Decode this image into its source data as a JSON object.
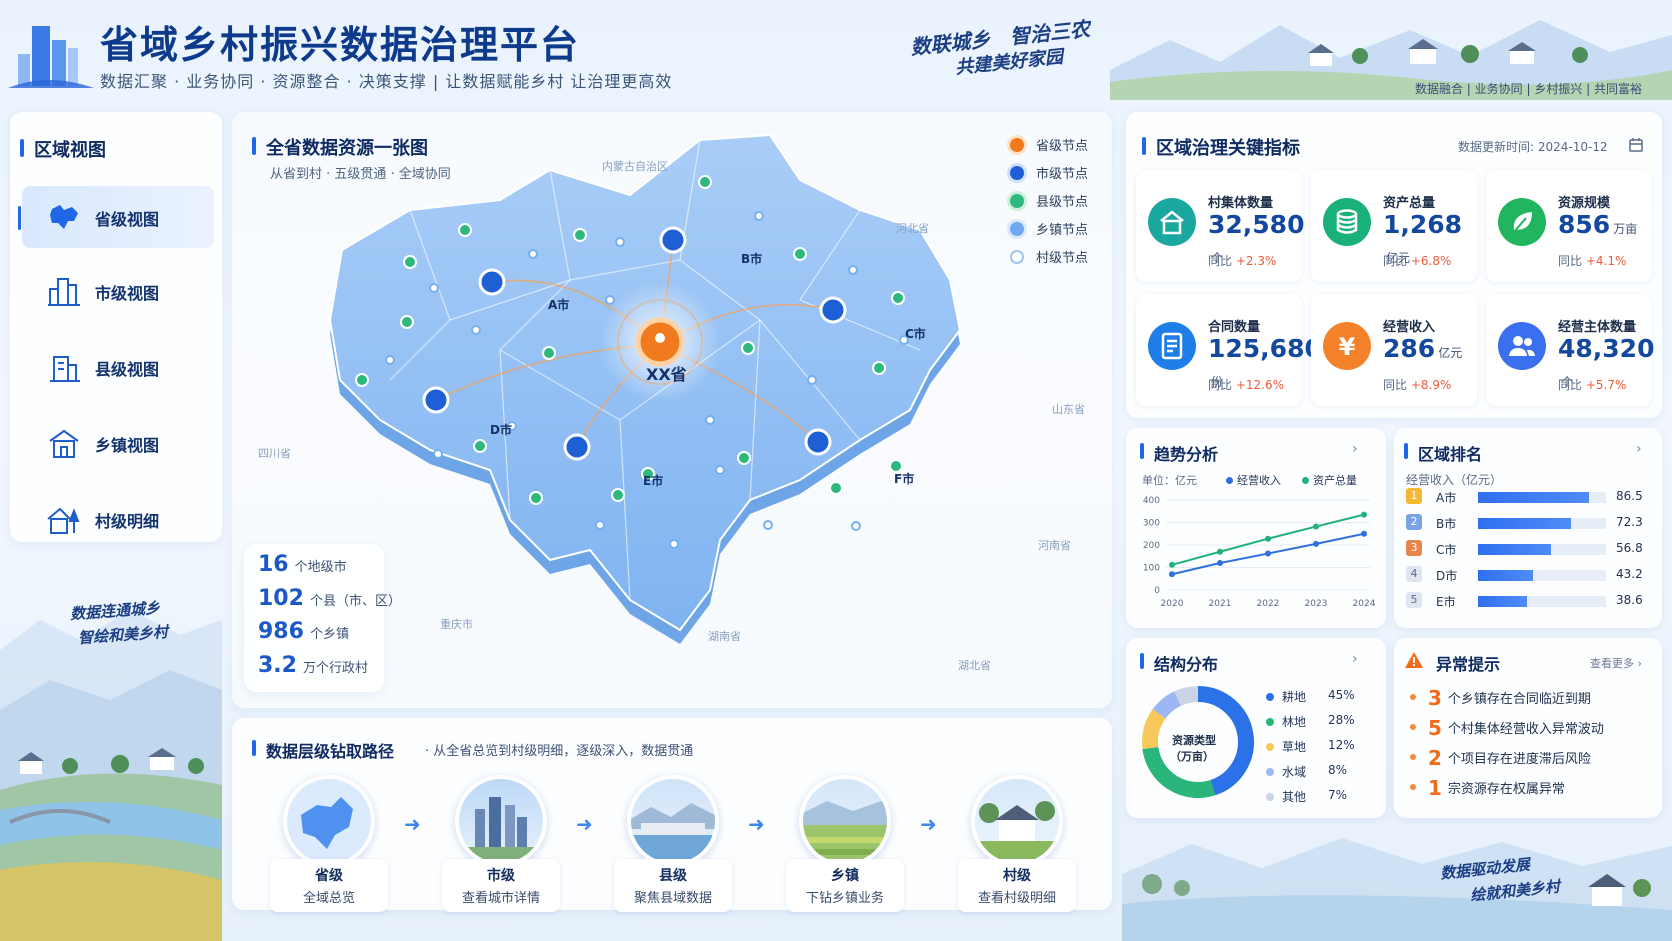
{
  "header": {
    "title": "省域乡村振兴数据治理平台",
    "subtitle": "数据汇聚 · 业务协同 · 资源整合 · 决策支撑 | 让数据赋能乡村 让治理更高效",
    "slogan_line1": "数联城乡　智治三农",
    "slogan_line2": "共建美好家园",
    "tagline": "数据融合 | 业务协同 | 乡村振兴 | 共同富裕"
  },
  "sidebar": {
    "title": "区域视图",
    "items": [
      {
        "label": "省级视图",
        "icon": "province-map-icon",
        "active": true
      },
      {
        "label": "市级视图",
        "icon": "city-building-icon",
        "active": false
      },
      {
        "label": "县级视图",
        "icon": "county-building-icon",
        "active": false
      },
      {
        "label": "乡镇视图",
        "icon": "town-house-icon",
        "active": false
      },
      {
        "label": "村级明细",
        "icon": "village-house-icon",
        "active": false
      }
    ],
    "slogan_line1": "数据连通城乡",
    "slogan_line2": "智绘和美乡村"
  },
  "map": {
    "title": "全省数据资源一张图",
    "subtitle": "从省到村 · 五级贯通 · 全域协同",
    "center_label": "XX省",
    "cities": [
      "A市",
      "B市",
      "C市",
      "D市",
      "E市",
      "F市"
    ],
    "regions": [
      "内蒙古自治区",
      "河北省",
      "山东省",
      "河南省",
      "湖北省",
      "湖南省",
      "重庆市",
      "四川省"
    ],
    "legend": [
      "省级节点",
      "市级节点",
      "县级节点",
      "乡镇节点",
      "村级节点"
    ],
    "stats": [
      {
        "value": "16",
        "label": "个地级市"
      },
      {
        "value": "102",
        "label": "个县（市、区）"
      },
      {
        "value": "986",
        "label": "个乡镇"
      },
      {
        "value": "3.2",
        "label": "万个行政村"
      }
    ]
  },
  "kpi": {
    "title": "区域治理关键指标",
    "update_label": "数据更新时间:",
    "update_date": "2024-10-12",
    "items": [
      {
        "label": "村集体数量",
        "value": "32,580",
        "unit": "个",
        "yoy": "+2.3%",
        "yoy_label": "同比",
        "color": "#1aa7a0",
        "icon": "village-collective-icon"
      },
      {
        "label": "资产总量",
        "value": "1,268",
        "unit": "亿元",
        "yoy": "+6.8%",
        "yoy_label": "同比",
        "color": "#19b07a",
        "icon": "coins-icon"
      },
      {
        "label": "资源规模",
        "value": "856",
        "unit": "万亩",
        "yoy": "+4.1%",
        "yoy_label": "同比",
        "color": "#22b560",
        "icon": "leaf-icon"
      },
      {
        "label": "合同数量",
        "value": "125,680",
        "unit": "份",
        "yoy": "+12.6%",
        "yoy_label": "同比",
        "color": "#1e7ee8",
        "icon": "contract-icon"
      },
      {
        "label": "经营收入",
        "value": "286",
        "unit": "亿元",
        "yoy": "+8.9%",
        "yoy_label": "同比",
        "color": "#f3822b",
        "icon": "yuan-icon"
      },
      {
        "label": "经营主体数量",
        "value": "48,320",
        "unit": "个",
        "yoy": "+5.7%",
        "yoy_label": "同比",
        "color": "#3a6ff0",
        "icon": "people-icon"
      }
    ]
  },
  "trend": {
    "title": "趋势分析",
    "unit": "单位：亿元",
    "y_ticks": [
      "400",
      "300",
      "200",
      "100",
      "0"
    ]
  },
  "chart_data": [
    {
      "type": "line",
      "title": "趋势分析",
      "ylabel": "单位：亿元",
      "x": [
        "2020",
        "2021",
        "2022",
        "2023",
        "2024"
      ],
      "ylim": [
        0,
        400
      ],
      "series": [
        {
          "name": "经营收入",
          "color": "#2f6fe0",
          "values": [
            70,
            120,
            162,
            205,
            250
          ]
        },
        {
          "name": "资产总量",
          "color": "#20b27a",
          "values": [
            112,
            170,
            228,
            282,
            335
          ]
        }
      ],
      "grid": true,
      "legend": "top"
    },
    {
      "type": "bar",
      "title": "区域排名",
      "ylabel": "经营收入（亿元）",
      "categories": [
        "A市",
        "B市",
        "C市",
        "D市",
        "E市"
      ],
      "values": [
        86.5,
        72.3,
        56.8,
        43.2,
        38.6
      ]
    },
    {
      "type": "pie",
      "title": "结构分布",
      "center_label": "资源类型（万亩）",
      "categories": [
        "耕地",
        "林地",
        "草地",
        "水域",
        "其他"
      ],
      "values": [
        45,
        28,
        12,
        8,
        7
      ],
      "colors": [
        "#2b72e8",
        "#2ab57a",
        "#f7c95a",
        "#9db7f5",
        "#c9d4e4"
      ]
    }
  ],
  "ranking": {
    "title": "区域排名",
    "subtitle": "经营收入（亿元）",
    "items": [
      {
        "rank": "1",
        "name": "A市",
        "value": "86.5",
        "share": 0.865,
        "color": "#f6b733"
      },
      {
        "rank": "2",
        "name": "B市",
        "value": "72.3",
        "share": 0.723,
        "color": "#7aa2e6"
      },
      {
        "rank": "3",
        "name": "C市",
        "value": "56.8",
        "share": 0.568,
        "color": "#e7864a"
      },
      {
        "rank": "4",
        "name": "D市",
        "value": "43.2",
        "share": 0.432,
        "color": "#dfe6f1"
      },
      {
        "rank": "5",
        "name": "E市",
        "value": "38.6",
        "share": 0.386,
        "color": "#dfe6f1"
      }
    ]
  },
  "structure": {
    "title": "结构分布",
    "center_line1": "资源类型",
    "center_line2": "（万亩）",
    "items": [
      {
        "name": "耕地",
        "pct": "45%"
      },
      {
        "name": "林地",
        "pct": "28%"
      },
      {
        "name": "草地",
        "pct": "12%"
      },
      {
        "name": "水域",
        "pct": "8%"
      },
      {
        "name": "其他",
        "pct": "7%"
      }
    ]
  },
  "alerts": {
    "title": "异常提示",
    "more": "查看更多 ›",
    "items": [
      {
        "num": "3",
        "text": "个乡镇存在合同临近到期"
      },
      {
        "num": "5",
        "text": "个村集体经营收入异常波动"
      },
      {
        "num": "2",
        "text": "个项目存在进度滞后风险"
      },
      {
        "num": "1",
        "text": "宗资源存在权属异常"
      }
    ]
  },
  "drill": {
    "title": "数据层级钻取路径",
    "subtitle": "· 从全省总览到村级明细，逐级深入，数据贯通",
    "levels": [
      {
        "name": "省级",
        "desc": "全域总览"
      },
      {
        "name": "市级",
        "desc": "查看城市详情"
      },
      {
        "name": "县级",
        "desc": "聚焦县域数据"
      },
      {
        "name": "乡镇",
        "desc": "下钻乡镇业务"
      },
      {
        "name": "村级",
        "desc": "查看村级明细"
      }
    ]
  },
  "footer_slogan": {
    "line1": "数据驱动发展",
    "line2": "绘就和美乡村"
  }
}
